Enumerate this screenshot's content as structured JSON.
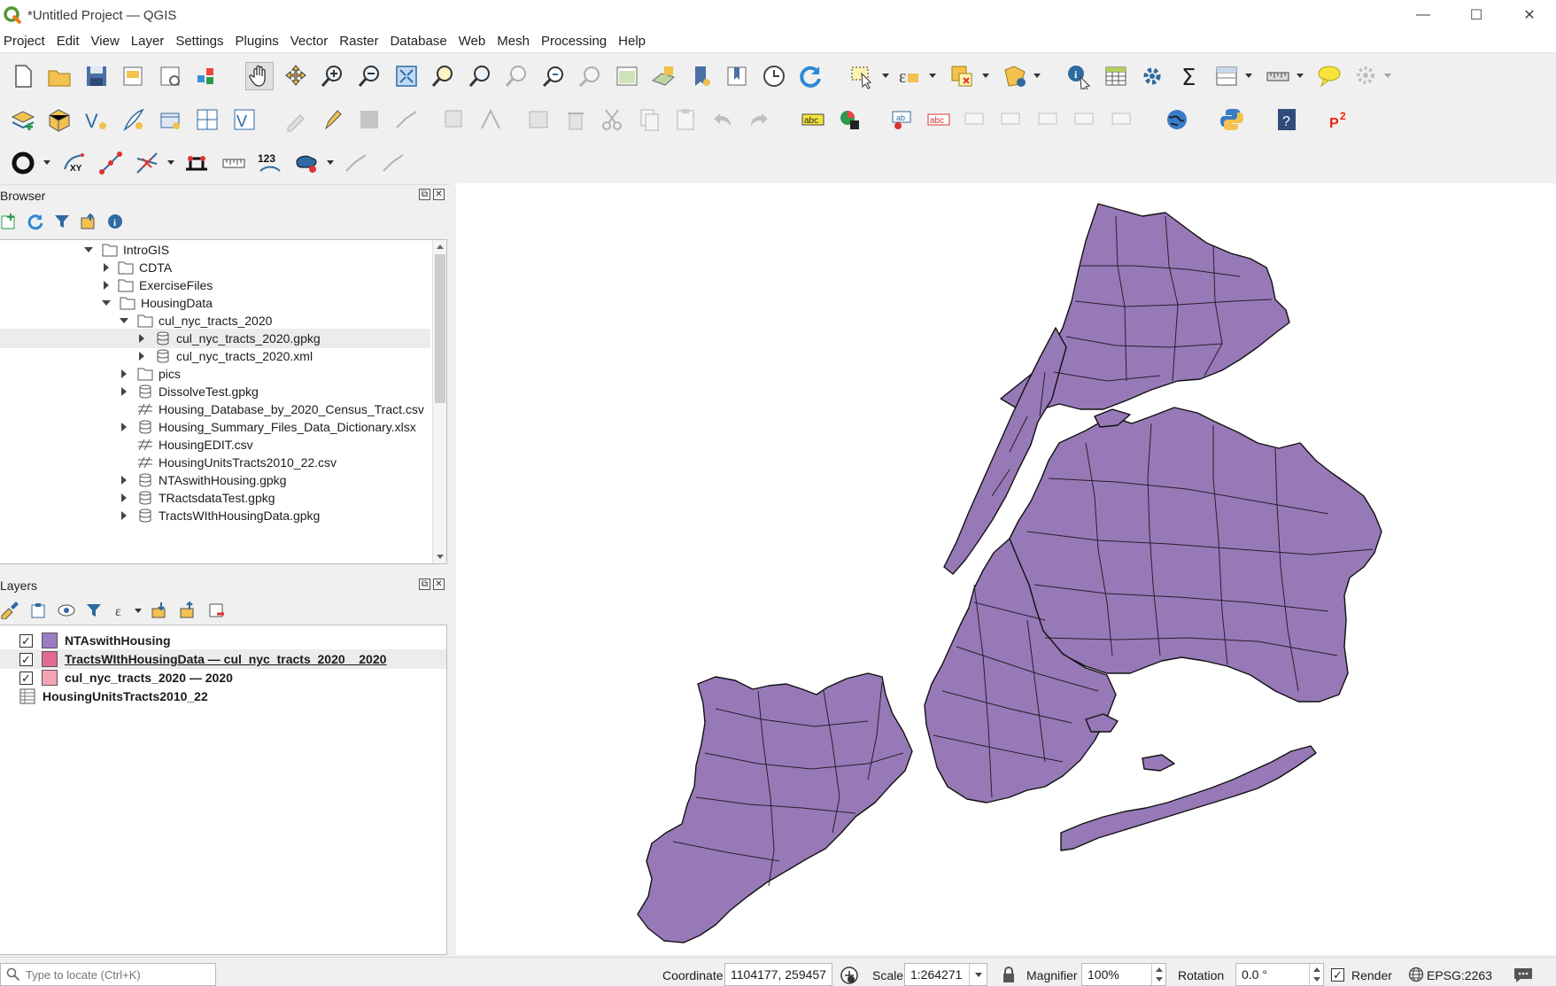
{
  "window": {
    "title": "*Untitled Project — QGIS",
    "minimize": "—",
    "maximize": "☐",
    "close": "✕"
  },
  "menubar": [
    "Project",
    "Edit",
    "View",
    "Layer",
    "Settings",
    "Plugins",
    "Vector",
    "Raster",
    "Database",
    "Web",
    "Mesh",
    "Processing",
    "Help"
  ],
  "toolbar_icons": {
    "row1": [
      "new-project",
      "open-project",
      "save-project",
      "new-print-layout",
      "layout-manager",
      "style-manager",
      "pan",
      "pan-to-selection",
      "zoom-in",
      "zoom-out",
      "zoom-full",
      "zoom-to-selection",
      "zoom-to-layer",
      "zoom-native",
      "zoom-last",
      "zoom-next",
      "new-map-view",
      "new-3d-map",
      "new-bookmark",
      "show-bookmarks",
      "temporal-controller",
      "refresh",
      "select-features",
      "select-by-expression",
      "deselect",
      "select-by-location",
      "identify",
      "attribute-table-open",
      "processing-toolbox",
      "statistical-summary",
      "open-field-calculator",
      "measure",
      "map-tips",
      "georeferencer"
    ],
    "row2": [
      "open-data-source-manager",
      "new-geopackage-layer",
      "new-shapefile-layer",
      "new-spatialite",
      "new-temporary-scratch-layer",
      "new-virtual-layer",
      "current-edits",
      "toggle-editing",
      "save-edits",
      "digitize",
      "add-ring",
      "vertex-tool",
      "modify-attributes",
      "delete-selected",
      "cut-features",
      "copy-features",
      "paste-features",
      "undo",
      "redo",
      "label-toolbar",
      "diagram-toolbar",
      "pin-labels",
      "show-hide-labels",
      "python-console",
      "help",
      "p2-plugin"
    ],
    "row3": [
      "circle-digitize",
      "xy-tool",
      "line-tool",
      "split-tool",
      "topology-tool",
      "ruler",
      "123-tool",
      "shape-tool",
      "offset-tool",
      "reshape-tool"
    ]
  },
  "browser": {
    "title": "Browser",
    "items": [
      {
        "label": "IntroGIS",
        "icon": "folder"
      },
      {
        "label": "CDTA",
        "icon": "folder"
      },
      {
        "label": "ExerciseFiles",
        "icon": "folder"
      },
      {
        "label": "HousingData",
        "icon": "folder"
      },
      {
        "label": "cul_nyc_tracts_2020",
        "icon": "folder"
      },
      {
        "label": "cul_nyc_tracts_2020.gpkg",
        "icon": "database"
      },
      {
        "label": "cul_nyc_tracts_2020.xml",
        "icon": "database"
      },
      {
        "label": "pics",
        "icon": "folder"
      },
      {
        "label": "DissolveTest.gpkg",
        "icon": "database"
      },
      {
        "label": "Housing_Database_by_2020_Census_Tract.csv",
        "icon": "delimited-text"
      },
      {
        "label": "Housing_Summary_Files_Data_Dictionary.xlsx",
        "icon": "database"
      },
      {
        "label": "HousingEDIT.csv",
        "icon": "delimited-text"
      },
      {
        "label": "HousingUnitsTracts2010_22.csv",
        "icon": "delimited-text"
      },
      {
        "label": "NTAswithHousing.gpkg",
        "icon": "database"
      },
      {
        "label": "TRactsdataTest.gpkg",
        "icon": "database"
      },
      {
        "label": "TractsWIthHousingData.gpkg",
        "icon": "database"
      }
    ]
  },
  "layers": {
    "title": "Layers",
    "items": [
      {
        "name": "NTAswithHousing",
        "checked": "✓",
        "color": "#9b7cc2"
      },
      {
        "name": "TractsWIthHousingData — cul_nyc_tracts_2020__2020",
        "checked": "✓",
        "color": "#e36b8f"
      },
      {
        "name": "cul_nyc_tracts_2020 — 2020",
        "checked": "✓",
        "color": "#f4a3b4"
      },
      {
        "name": "HousingUnitsTracts2010_22",
        "checked": "",
        "color": ""
      }
    ]
  },
  "map": {
    "fill_color": "#9779b8",
    "stroke_color": "#111111"
  },
  "statusbar": {
    "locator_placeholder": "Type to locate (Ctrl+K)",
    "coordinate_label": "Coordinate",
    "coordinate_value": "1104177, 259457",
    "scale_label": "Scale",
    "scale_value": "1:264271",
    "magnifier_label": "Magnifier",
    "magnifier_value": "100%",
    "rotation_label": "Rotation",
    "rotation_value": "0.0 °",
    "render_label": "Render",
    "render_checked": "✓",
    "crs": "EPSG:2263"
  }
}
